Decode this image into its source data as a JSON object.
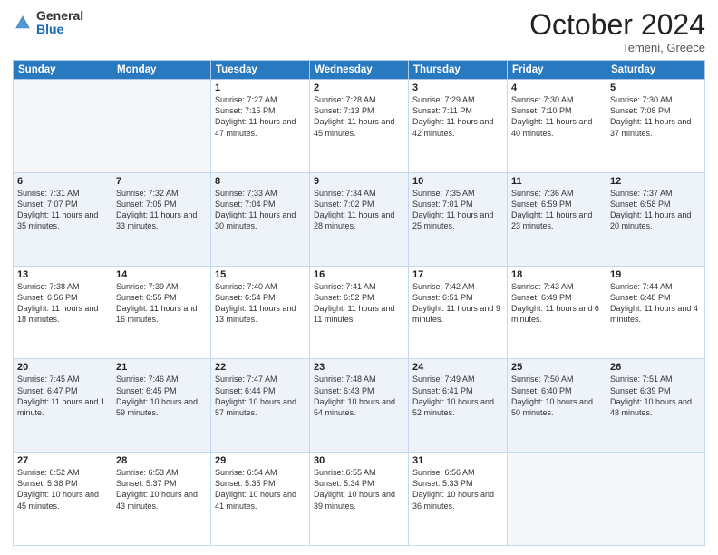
{
  "header": {
    "logo": {
      "general": "General",
      "blue": "Blue"
    },
    "title": "October 2024",
    "location": "Temeni, Greece"
  },
  "days_of_week": [
    "Sunday",
    "Monday",
    "Tuesday",
    "Wednesday",
    "Thursday",
    "Friday",
    "Saturday"
  ],
  "weeks": [
    {
      "shaded": false,
      "days": [
        {
          "num": "",
          "info": ""
        },
        {
          "num": "",
          "info": ""
        },
        {
          "num": "1",
          "info": "Sunrise: 7:27 AM\nSunset: 7:15 PM\nDaylight: 11 hours and 47 minutes."
        },
        {
          "num": "2",
          "info": "Sunrise: 7:28 AM\nSunset: 7:13 PM\nDaylight: 11 hours and 45 minutes."
        },
        {
          "num": "3",
          "info": "Sunrise: 7:29 AM\nSunset: 7:11 PM\nDaylight: 11 hours and 42 minutes."
        },
        {
          "num": "4",
          "info": "Sunrise: 7:30 AM\nSunset: 7:10 PM\nDaylight: 11 hours and 40 minutes."
        },
        {
          "num": "5",
          "info": "Sunrise: 7:30 AM\nSunset: 7:08 PM\nDaylight: 11 hours and 37 minutes."
        }
      ]
    },
    {
      "shaded": true,
      "days": [
        {
          "num": "6",
          "info": "Sunrise: 7:31 AM\nSunset: 7:07 PM\nDaylight: 11 hours and 35 minutes."
        },
        {
          "num": "7",
          "info": "Sunrise: 7:32 AM\nSunset: 7:05 PM\nDaylight: 11 hours and 33 minutes."
        },
        {
          "num": "8",
          "info": "Sunrise: 7:33 AM\nSunset: 7:04 PM\nDaylight: 11 hours and 30 minutes."
        },
        {
          "num": "9",
          "info": "Sunrise: 7:34 AM\nSunset: 7:02 PM\nDaylight: 11 hours and 28 minutes."
        },
        {
          "num": "10",
          "info": "Sunrise: 7:35 AM\nSunset: 7:01 PM\nDaylight: 11 hours and 25 minutes."
        },
        {
          "num": "11",
          "info": "Sunrise: 7:36 AM\nSunset: 6:59 PM\nDaylight: 11 hours and 23 minutes."
        },
        {
          "num": "12",
          "info": "Sunrise: 7:37 AM\nSunset: 6:58 PM\nDaylight: 11 hours and 20 minutes."
        }
      ]
    },
    {
      "shaded": false,
      "days": [
        {
          "num": "13",
          "info": "Sunrise: 7:38 AM\nSunset: 6:56 PM\nDaylight: 11 hours and 18 minutes."
        },
        {
          "num": "14",
          "info": "Sunrise: 7:39 AM\nSunset: 6:55 PM\nDaylight: 11 hours and 16 minutes."
        },
        {
          "num": "15",
          "info": "Sunrise: 7:40 AM\nSunset: 6:54 PM\nDaylight: 11 hours and 13 minutes."
        },
        {
          "num": "16",
          "info": "Sunrise: 7:41 AM\nSunset: 6:52 PM\nDaylight: 11 hours and 11 minutes."
        },
        {
          "num": "17",
          "info": "Sunrise: 7:42 AM\nSunset: 6:51 PM\nDaylight: 11 hours and 9 minutes."
        },
        {
          "num": "18",
          "info": "Sunrise: 7:43 AM\nSunset: 6:49 PM\nDaylight: 11 hours and 6 minutes."
        },
        {
          "num": "19",
          "info": "Sunrise: 7:44 AM\nSunset: 6:48 PM\nDaylight: 11 hours and 4 minutes."
        }
      ]
    },
    {
      "shaded": true,
      "days": [
        {
          "num": "20",
          "info": "Sunrise: 7:45 AM\nSunset: 6:47 PM\nDaylight: 11 hours and 1 minute."
        },
        {
          "num": "21",
          "info": "Sunrise: 7:46 AM\nSunset: 6:45 PM\nDaylight: 10 hours and 59 minutes."
        },
        {
          "num": "22",
          "info": "Sunrise: 7:47 AM\nSunset: 6:44 PM\nDaylight: 10 hours and 57 minutes."
        },
        {
          "num": "23",
          "info": "Sunrise: 7:48 AM\nSunset: 6:43 PM\nDaylight: 10 hours and 54 minutes."
        },
        {
          "num": "24",
          "info": "Sunrise: 7:49 AM\nSunset: 6:41 PM\nDaylight: 10 hours and 52 minutes."
        },
        {
          "num": "25",
          "info": "Sunrise: 7:50 AM\nSunset: 6:40 PM\nDaylight: 10 hours and 50 minutes."
        },
        {
          "num": "26",
          "info": "Sunrise: 7:51 AM\nSunset: 6:39 PM\nDaylight: 10 hours and 48 minutes."
        }
      ]
    },
    {
      "shaded": false,
      "days": [
        {
          "num": "27",
          "info": "Sunrise: 6:52 AM\nSunset: 5:38 PM\nDaylight: 10 hours and 45 minutes."
        },
        {
          "num": "28",
          "info": "Sunrise: 6:53 AM\nSunset: 5:37 PM\nDaylight: 10 hours and 43 minutes."
        },
        {
          "num": "29",
          "info": "Sunrise: 6:54 AM\nSunset: 5:35 PM\nDaylight: 10 hours and 41 minutes."
        },
        {
          "num": "30",
          "info": "Sunrise: 6:55 AM\nSunset: 5:34 PM\nDaylight: 10 hours and 39 minutes."
        },
        {
          "num": "31",
          "info": "Sunrise: 6:56 AM\nSunset: 5:33 PM\nDaylight: 10 hours and 36 minutes."
        },
        {
          "num": "",
          "info": ""
        },
        {
          "num": "",
          "info": ""
        }
      ]
    }
  ]
}
